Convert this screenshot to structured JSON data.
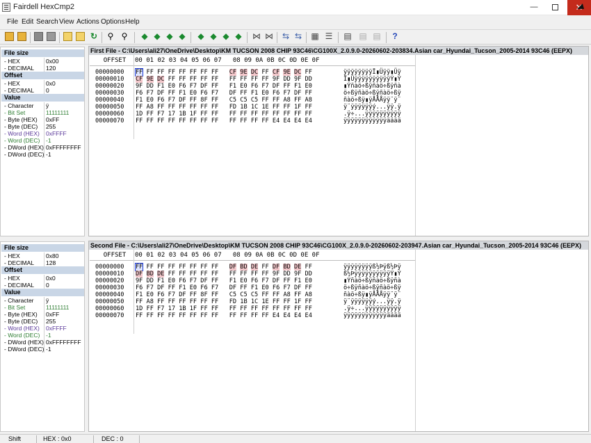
{
  "window": {
    "title": "Fairdell HexCmp2",
    "minimize": "—",
    "close": "✕"
  },
  "menu": [
    "File",
    "Edit",
    "Search",
    "View",
    "Actions",
    "Options",
    "Help"
  ],
  "toolbar_icons": [
    "open-icon",
    "open-second-icon",
    "save-icon",
    "save-second-icon",
    "first-diff-icon",
    "next-diff-icon",
    "refresh-icon",
    "find-icon",
    "find-next-icon",
    "jump-left-icon",
    "jump-down-icon",
    "jump-right-icon",
    "jump-end-icon",
    "nav-left-icon",
    "nav-down-icon",
    "nav-right-icon",
    "nav-end-icon",
    "compare-icon",
    "compare-alt-icon",
    "sync-left-icon",
    "sync-right-icon",
    "column-icon",
    "list-icon",
    "report-icon",
    "print-icon",
    "print-preview-icon",
    "help-icon"
  ],
  "hex_header": {
    "offset": "OFFSET",
    "columns": "00 01 02 03 04 05 06 07   08 09 0A 0B 0C 0D 0E 0F"
  },
  "first": {
    "title": "First File - C:\\Users\\ali27\\OneDrive\\Desktop\\KM TUCSON 2008 CHIP 93C46\\CG100X_2.0.9.0-20260602-203834.Asian car_Hyundai_Tucson_2005-2014 93C46 (EEPX)",
    "props": {
      "file_size": "File size",
      "hex_lbl": "- HEX",
      "hex_val": "0x00",
      "dec_lbl": "- DECIMAL",
      "dec_val": "120",
      "offset": "Offset",
      "ohex_lbl": "- HEX",
      "ohex_val": "0x0",
      "odec_lbl": "- DECIMAL",
      "odec_val": "0",
      "value": "Value",
      "char_lbl": "- Character",
      "char_val": "ÿ",
      "bits_lbl": "- Bit Set",
      "bits_val": "11111111",
      "bhex_lbl": "- Byte (HEX)",
      "bhex_val": "0xFF",
      "bdec_lbl": "- Byte (DEC)",
      "bdec_val": "255",
      "whex_lbl": "- Word (HEX)",
      "whex_val": "0xFFFF",
      "wdec_lbl": "- Word (DEC)",
      "wdec_val": "-1",
      "dwhex_lbl": "- DWord (HEX)",
      "dwhex_val": "0xFFFFFFFF",
      "dwdec_lbl": "- DWord (DEC)",
      "dwdec_val": "-1"
    },
    "rows": [
      {
        "off": "00000000",
        "bytes": [
          "FF",
          "FF",
          "FF",
          "FF",
          "FF",
          "FF",
          "FF",
          "FF",
          "CF",
          "9E",
          "DC",
          "FF",
          "CF",
          "9E",
          "DC",
          "FF"
        ],
        "hl": [
          8,
          9,
          10,
          12,
          13,
          14
        ],
        "ascii": "ÿÿÿÿÿÿÿÿÏ▮Üÿÿ▮Üÿ"
      },
      {
        "off": "00000010",
        "bytes": [
          "CF",
          "9E",
          "DC",
          "FF",
          "FF",
          "FF",
          "FF",
          "FF",
          "FF",
          "FF",
          "FF",
          "FF",
          "9F",
          "DD",
          "9F",
          "DD"
        ],
        "hl": [
          0,
          1,
          2
        ],
        "ascii": "Ï▮ÜÿÿÿÿÿÿÿÿÿÿÝ▮Ý"
      },
      {
        "off": "00000020",
        "bytes": [
          "9F",
          "DD",
          "F1",
          "E0",
          "F6",
          "F7",
          "DF",
          "FF",
          "F1",
          "E0",
          "F6",
          "F7",
          "DF",
          "FF",
          "F1",
          "E0"
        ],
        "hl": [],
        "ascii": "▮Ýñàö÷ßÿñàö÷ßÿñà"
      },
      {
        "off": "00000030",
        "bytes": [
          "F6",
          "F7",
          "DF",
          "FF",
          "F1",
          "E0",
          "F6",
          "F7",
          "DF",
          "FF",
          "F1",
          "E0",
          "F6",
          "F7",
          "DF",
          "FF"
        ],
        "hl": [],
        "ascii": "ö÷ßÿñàö÷ßÿñàö÷ßÿ"
      },
      {
        "off": "00000040",
        "bytes": [
          "F1",
          "E0",
          "F6",
          "F7",
          "DF",
          "FF",
          "8F",
          "FF",
          "C5",
          "C5",
          "C5",
          "FF",
          "FF",
          "A8",
          "FF",
          "A8"
        ],
        "hl": [],
        "ascii": "ñàö÷ßÿ▮ÿÅÅÅÿÿ¨ÿ¨"
      },
      {
        "off": "00000050",
        "bytes": [
          "FF",
          "A8",
          "FF",
          "FF",
          "FF",
          "FF",
          "FF",
          "FF",
          "FD",
          "1B",
          "1C",
          "1E",
          "FF",
          "FF",
          "1F",
          "FF"
        ],
        "hl": [],
        "ascii": "ÿ¨ÿÿÿÿÿÿý...ÿÿ.ÿ"
      },
      {
        "off": "00000060",
        "bytes": [
          "1D",
          "FF",
          "F7",
          "17",
          "1B",
          "1F",
          "FF",
          "FF",
          "FF",
          "FF",
          "FF",
          "FF",
          "FF",
          "FF",
          "FF",
          "FF"
        ],
        "hl": [],
        "ascii": ".ÿ÷...ÿÿÿÿÿÿÿÿÿÿ"
      },
      {
        "off": "00000070",
        "bytes": [
          "FF",
          "FF",
          "FF",
          "FF",
          "FF",
          "FF",
          "FF",
          "FF",
          "FF",
          "FF",
          "FF",
          "FF",
          "E4",
          "E4",
          "E4",
          "E4"
        ],
        "hl": [],
        "ascii": "ÿÿÿÿÿÿÿÿÿÿÿÿääää"
      }
    ]
  },
  "second": {
    "title": "Second File - C:\\Users\\ali27\\OneDrive\\Desktop\\KM TUCSON 2008 CHIP 93C46\\CG100X_2.0.9.0-20260602-203947.Asian car_Hyundai_Tucson_2005-2014 93C46 (EEPX)",
    "props": {
      "file_size": "File size",
      "hex_lbl": "- HEX",
      "hex_val": "0x80",
      "dec_lbl": "- DECIMAL",
      "dec_val": "128",
      "offset": "Offset",
      "ohex_lbl": "- HEX",
      "ohex_val": "0x0",
      "odec_lbl": "- DECIMAL",
      "odec_val": "0",
      "value": "Value",
      "char_lbl": "- Character",
      "char_val": "ÿ",
      "bits_lbl": "- Bit Set",
      "bits_val": "11111111",
      "bhex_lbl": "- Byte (HEX)",
      "bhex_val": "0xFF",
      "bdec_lbl": "- Byte (DEC)",
      "bdec_val": "255",
      "whex_lbl": "- Word (HEX)",
      "whex_val": "0xFFFF",
      "wdec_lbl": "- Word (DEC)",
      "wdec_val": "-1",
      "dwhex_lbl": "- DWord (HEX)",
      "dwhex_val": "0xFFFFFFFF",
      "dwdec_lbl": "- DWord (DEC)",
      "dwdec_val": "-1"
    },
    "rows": [
      {
        "off": "00000000",
        "bytes": [
          "FF",
          "FF",
          "FF",
          "FF",
          "FF",
          "FF",
          "FF",
          "FF",
          "DF",
          "BD",
          "DE",
          "FF",
          "DF",
          "BD",
          "DE",
          "FF"
        ],
        "hl": [
          8,
          9,
          10,
          12,
          13,
          14
        ],
        "ascii": "ÿÿÿÿÿÿÿÿß½Þÿß½Þÿ"
      },
      {
        "off": "00000010",
        "bytes": [
          "DF",
          "BD",
          "DE",
          "FF",
          "FF",
          "FF",
          "FF",
          "FF",
          "FF",
          "FF",
          "FF",
          "FF",
          "9F",
          "DD",
          "9F",
          "DD"
        ],
        "hl": [
          0,
          1,
          2
        ],
        "ascii": "ß½ÞÿÿÿÿÿÿÿÿÿÿÝ▮Ý"
      },
      {
        "off": "00000020",
        "bytes": [
          "9F",
          "DD",
          "F1",
          "E0",
          "F6",
          "F7",
          "DF",
          "FF",
          "F1",
          "E0",
          "F6",
          "F7",
          "DF",
          "FF",
          "F1",
          "E0"
        ],
        "hl": [],
        "ascii": "▮Ýñàö÷ßÿñàö÷ßÿñà"
      },
      {
        "off": "00000030",
        "bytes": [
          "F6",
          "F7",
          "DF",
          "FF",
          "F1",
          "E0",
          "F6",
          "F7",
          "DF",
          "FF",
          "F1",
          "E0",
          "F6",
          "F7",
          "DF",
          "FF"
        ],
        "hl": [],
        "ascii": "ö÷ßÿñàö÷ßÿñàö÷ßÿ"
      },
      {
        "off": "00000040",
        "bytes": [
          "F1",
          "E0",
          "F6",
          "F7",
          "DF",
          "FF",
          "8F",
          "FF",
          "C5",
          "C5",
          "C5",
          "FF",
          "FF",
          "A8",
          "FF",
          "A8"
        ],
        "hl": [],
        "ascii": "ñàö÷ßÿ▮ÿÅÅÅÿÿ¨ÿ¨"
      },
      {
        "off": "00000050",
        "bytes": [
          "FF",
          "A8",
          "FF",
          "FF",
          "FF",
          "FF",
          "FF",
          "FF",
          "FD",
          "1B",
          "1C",
          "1E",
          "FF",
          "FF",
          "1F",
          "FF"
        ],
        "hl": [],
        "ascii": "ÿ¨ÿÿÿÿÿÿý...ÿÿ.ÿ"
      },
      {
        "off": "00000060",
        "bytes": [
          "1D",
          "FF",
          "F7",
          "17",
          "1B",
          "1F",
          "FF",
          "FF",
          "FF",
          "FF",
          "FF",
          "FF",
          "FF",
          "FF",
          "FF",
          "FF"
        ],
        "hl": [],
        "ascii": ".ÿ÷...ÿÿÿÿÿÿÿÿÿÿ"
      },
      {
        "off": "00000070",
        "bytes": [
          "FF",
          "FF",
          "FF",
          "FF",
          "FF",
          "FF",
          "FF",
          "FF",
          "FF",
          "FF",
          "FF",
          "FF",
          "E4",
          "E4",
          "E4",
          "E4"
        ],
        "hl": [],
        "ascii": "ÿÿÿÿÿÿÿÿÿÿÿÿääää"
      }
    ]
  },
  "status": {
    "mode": "Shift",
    "hex": "HEX : 0x0",
    "dec": "DEC : 0"
  }
}
